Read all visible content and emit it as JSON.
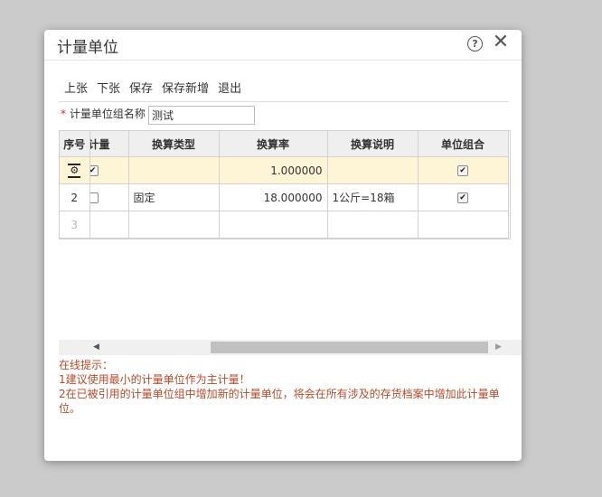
{
  "dialog": {
    "title": "计量单位",
    "help_icon": "help-circle-icon",
    "close_icon": "close-icon"
  },
  "toolbar": {
    "prev": "上张",
    "next": "下张",
    "save": "保存",
    "save_new": "保存新增",
    "exit": "退出"
  },
  "form": {
    "required_mark": "*",
    "group_name_label": "计量单位组名称",
    "group_name_value": "测试"
  },
  "grid": {
    "columns": [
      "序号",
      "主计量",
      "换算类型",
      "换算率",
      "换算说明",
      "单位组合"
    ],
    "rows": [
      {
        "index": "",
        "main_unit": true,
        "type": "",
        "rate": "1.000000",
        "desc": "",
        "combo": true,
        "selected": true
      },
      {
        "index": "2",
        "main_unit": false,
        "type": "固定",
        "rate": "18.000000",
        "desc": "1公斤=18箱",
        "combo": true,
        "selected": false
      },
      {
        "index": "3",
        "main_unit": null,
        "type": "",
        "rate": "",
        "desc": "",
        "combo": null,
        "selected": false
      }
    ]
  },
  "tips": {
    "title": "在线提示：",
    "line1": "1建议使用最小的计量单位作为主计量！",
    "line2": "2在已被引用的计量单位组中增加新的计量单位，将会在所有涉及的存货档案中增加此计量单位。"
  },
  "colors": {
    "selected_row": "#fdf5d6",
    "tip_text": "#b74a2a",
    "required": "#d9291c"
  }
}
